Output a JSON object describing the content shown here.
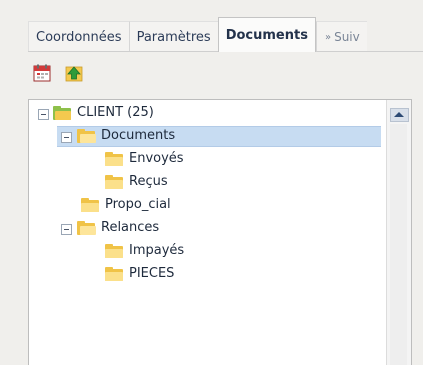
{
  "tabs": [
    {
      "label": "Coordonnées",
      "active": false
    },
    {
      "label": "Paramètres",
      "active": false
    },
    {
      "label": "Documents",
      "active": true
    },
    {
      "label": "Suiv",
      "marker": "»",
      "active": false
    }
  ],
  "toolbar": {
    "calendar_icon": "calendar-icon",
    "up_icon": "up-arrow-icon"
  },
  "tree": [
    {
      "label": "CLIENT (25)",
      "level": 0,
      "expanded": true,
      "icon": "root-folder-icon"
    },
    {
      "label": "Documents",
      "level": 1,
      "expanded": true,
      "selected": true,
      "icon": "folder-open-icon"
    },
    {
      "label": "Envoyés",
      "level": 2,
      "icon": "folder-icon"
    },
    {
      "label": "Reçus",
      "level": 2,
      "icon": "folder-icon"
    },
    {
      "label": "Propo_cial",
      "level": 1,
      "icon": "folder-icon"
    },
    {
      "label": "Relances",
      "level": 1,
      "expanded": true,
      "icon": "folder-open-icon"
    },
    {
      "label": "Impayés",
      "level": 2,
      "icon": "folder-icon"
    },
    {
      "label": "PIECES",
      "level": 2,
      "icon": "folder-icon"
    }
  ],
  "colors": {
    "selection": "#c7dcf2",
    "folder": "#f0c347",
    "root_folder": "#8ec04a"
  }
}
